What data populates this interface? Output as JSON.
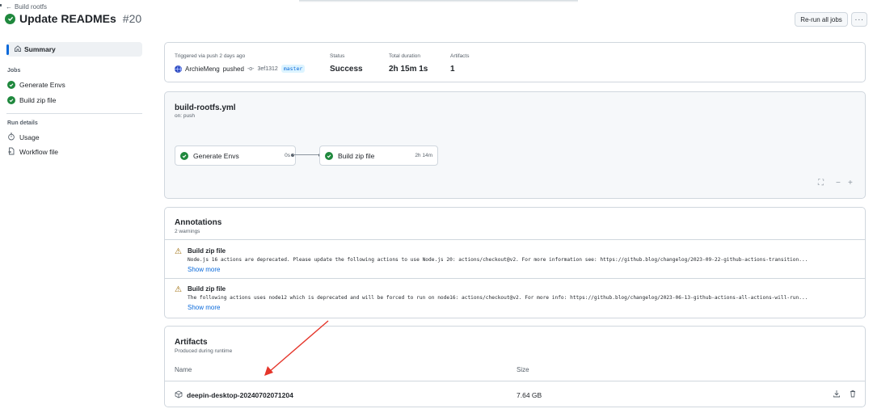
{
  "nav": {
    "back_label": "Build rootfs"
  },
  "run": {
    "title": "Update READMEs",
    "number": "#20",
    "status_icon": "check-circle-icon"
  },
  "header_actions": {
    "rerun_label": "Re-run all jobs",
    "more_label": "···"
  },
  "sidebar": {
    "summary_label": "Summary",
    "jobs_heading": "Jobs",
    "jobs": [
      {
        "label": "Generate Envs",
        "icon": "check-circle-icon"
      },
      {
        "label": "Build zip file",
        "icon": "check-circle-icon"
      }
    ],
    "details_heading": "Run details",
    "details": [
      {
        "label": "Usage",
        "icon": "stopwatch-icon"
      },
      {
        "label": "Workflow file",
        "icon": "file-icon"
      }
    ]
  },
  "summary": {
    "trigger_label": "Triggered via push 2 days ago",
    "actor": "ArchieMeng",
    "actor_action": "pushed",
    "commit": "3ef1312",
    "branch": "master",
    "status_label": "Status",
    "status_value": "Success",
    "duration_label": "Total duration",
    "duration_value": "2h 15m 1s",
    "artifacts_label": "Artifacts",
    "artifacts_value": "1"
  },
  "graph": {
    "workflow_file": "build-rootfs.yml",
    "trigger": "on: push",
    "jobs": [
      {
        "label": "Generate Envs",
        "duration": "0s"
      },
      {
        "label": "Build zip file",
        "duration": "2h 14m"
      }
    ],
    "zoom_controls": {
      "fullscreen": "⛶",
      "zoom_out": "−",
      "zoom_in": "+"
    }
  },
  "annotations": {
    "title": "Annotations",
    "count_label": "2 warnings",
    "items": [
      {
        "job": "Build zip file",
        "message": "Node.js 16 actions are deprecated. Please update the following actions to use Node.js 20: actions/checkout@v2. For more information see: https://github.blog/changelog/2023-09-22-github-actions-transition...",
        "show_more": "Show more"
      },
      {
        "job": "Build zip file",
        "message": "The following actions uses node12 which is deprecated and will be forced to run on node16: actions/checkout@v2. For more info: https://github.blog/changelog/2023-06-13-github-actions-all-actions-will-run...",
        "show_more": "Show more"
      }
    ]
  },
  "artifacts": {
    "title": "Artifacts",
    "subtitle": "Produced during runtime",
    "columns": {
      "name": "Name",
      "size": "Size"
    },
    "rows": [
      {
        "name": "deepin-desktop-20240702071204",
        "size": "7.64 GB"
      }
    ]
  },
  "colors": {
    "success": "#1f883d",
    "accent": "#0969da",
    "warning": "#9a6700",
    "arrow": "#e5362b"
  }
}
